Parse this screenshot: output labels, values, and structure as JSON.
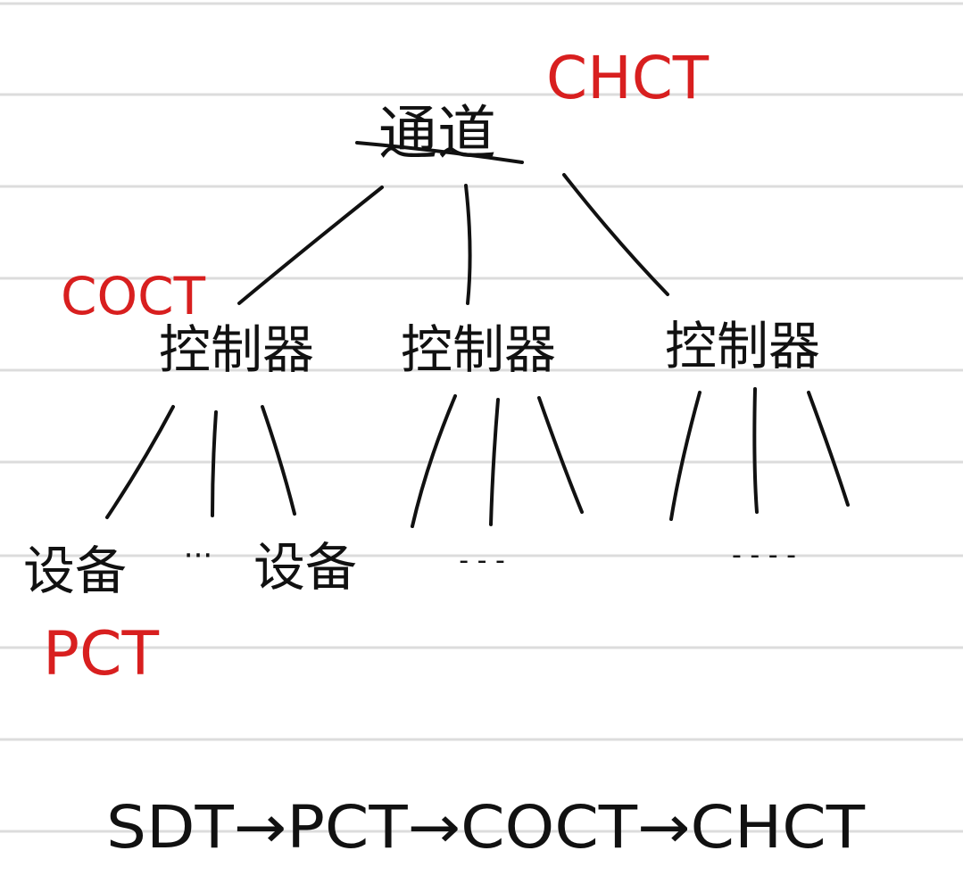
{
  "colors": {
    "ink": "#111111",
    "annotation": "#d81f1f",
    "ruled_line": "#dcdcdc",
    "background": "#ffffff"
  },
  "diagram": {
    "root": {
      "label": "通道",
      "annotation": "CHCT"
    },
    "controllers": [
      {
        "label": "控制器",
        "annotation": "COCT"
      },
      {
        "label": "控制器"
      },
      {
        "label": "控制器"
      }
    ],
    "devices": [
      {
        "label": "设备",
        "annotation": "PCT"
      },
      {
        "label": "···"
      },
      {
        "label": "设备"
      }
    ],
    "ellipses": [
      "- - -",
      "- - - -"
    ]
  },
  "footer": {
    "chain": "SDT→PCT→COCT→CHCT"
  }
}
